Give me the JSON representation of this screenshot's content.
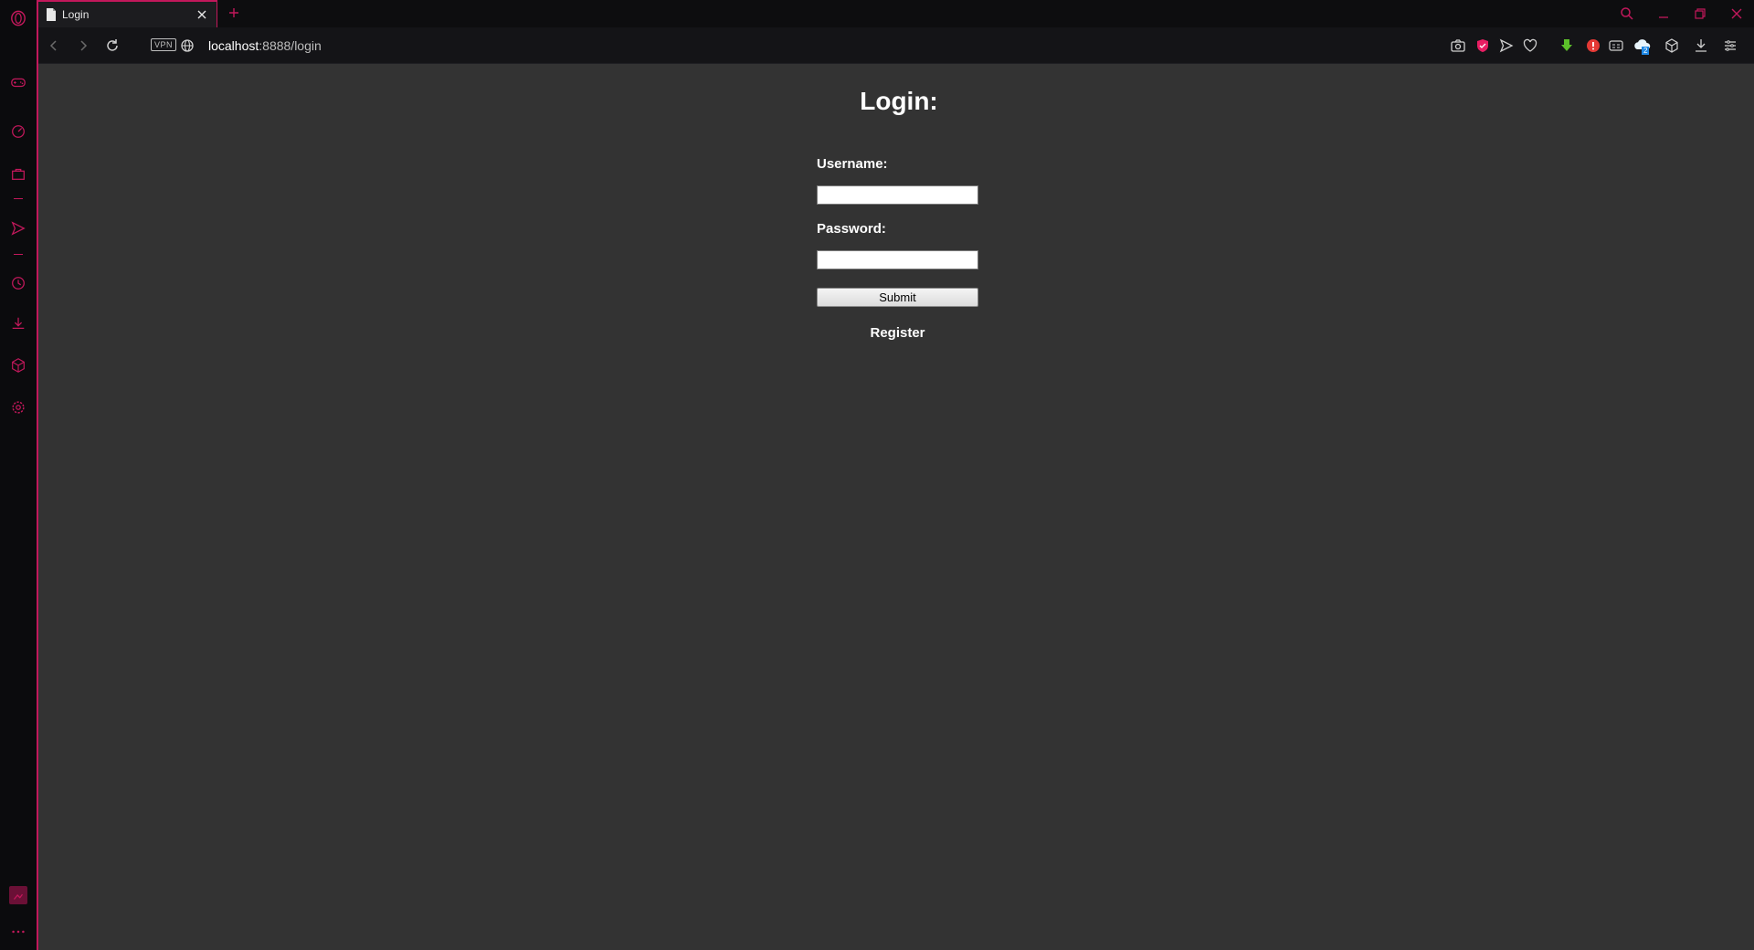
{
  "browser": {
    "tab_title": "Login",
    "url_host": "localhost",
    "url_rest": ":8888/login",
    "vpn_label": "VPN",
    "accent_color": "#c2185b",
    "sidebar_icons": [
      "opera-logo-icon",
      "gamepad-icon",
      "speed-dial-icon",
      "shop-bag-icon",
      "send-icon",
      "history-clock-icon",
      "downloads-icon",
      "cube-icon",
      "settings-gear-icon",
      "picture-icon",
      "more-dots-icon"
    ],
    "toolbar_icons": [
      "back-icon",
      "forward-icon",
      "reload-icon",
      "globe-icon",
      "camera-icon",
      "shield-icon",
      "send-icon",
      "heart-icon",
      "download-arrow-icon",
      "adblock-icon",
      "reader-icon",
      "cloud-icon",
      "cube-icon",
      "downloads-icon",
      "menu-icon"
    ],
    "cloud_badge": "2"
  },
  "page": {
    "heading": "Login:",
    "username_label": "Username:",
    "username_value": "",
    "password_label": "Password:",
    "password_value": "",
    "submit_label": "Submit",
    "register_label": "Register"
  }
}
